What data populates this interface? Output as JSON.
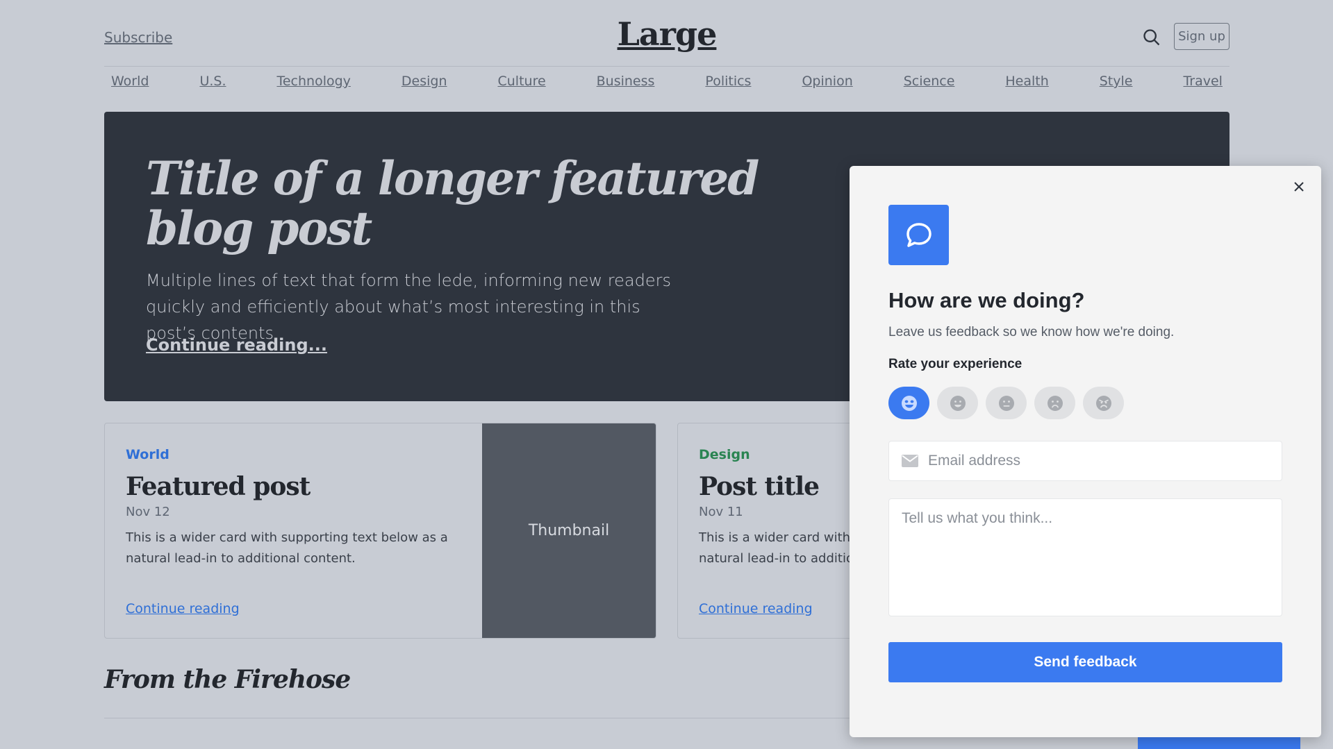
{
  "header": {
    "subscribe": "Subscribe",
    "brand": "Large",
    "signup": "Sign up"
  },
  "nav": [
    "World",
    "U.S.",
    "Technology",
    "Design",
    "Culture",
    "Business",
    "Politics",
    "Opinion",
    "Science",
    "Health",
    "Style",
    "Travel"
  ],
  "hero": {
    "title": "Title of a longer featured blog post",
    "lede": "Multiple lines of text that form the lede, informing new readers quickly and efficiently about what’s most interesting in this post’s contents.",
    "link": "Continue reading..."
  },
  "cards": [
    {
      "category": "World",
      "category_color": "#2f6fd6",
      "title": "Featured post",
      "date": "Nov 12",
      "text": "This is a wider card with supporting text below as a natural lead-in to additional content.",
      "link": "Continue reading",
      "thumbnail": "Thumbnail"
    },
    {
      "category": "Design",
      "category_color": "#2a8452",
      "title": "Post title",
      "date": "Nov 11",
      "text": "This is a wider card with supporting text below as a natural lead-in to additional content.",
      "link": "Continue reading"
    }
  ],
  "section_heading": "From the Firehose",
  "feedback": {
    "title": "How are we doing?",
    "subtitle": "Leave us feedback so we know how we're doing.",
    "rate_label": "Rate your experience",
    "ratings": [
      "very-happy-face-icon",
      "happy-face-icon",
      "neutral-face-icon",
      "sad-face-icon",
      "angry-face-icon"
    ],
    "selected_rating": 0,
    "email_placeholder": "Email address",
    "comment_placeholder": "Tell us what you think...",
    "send_label": "Send feedback",
    "accent": "#3b7af0"
  }
}
